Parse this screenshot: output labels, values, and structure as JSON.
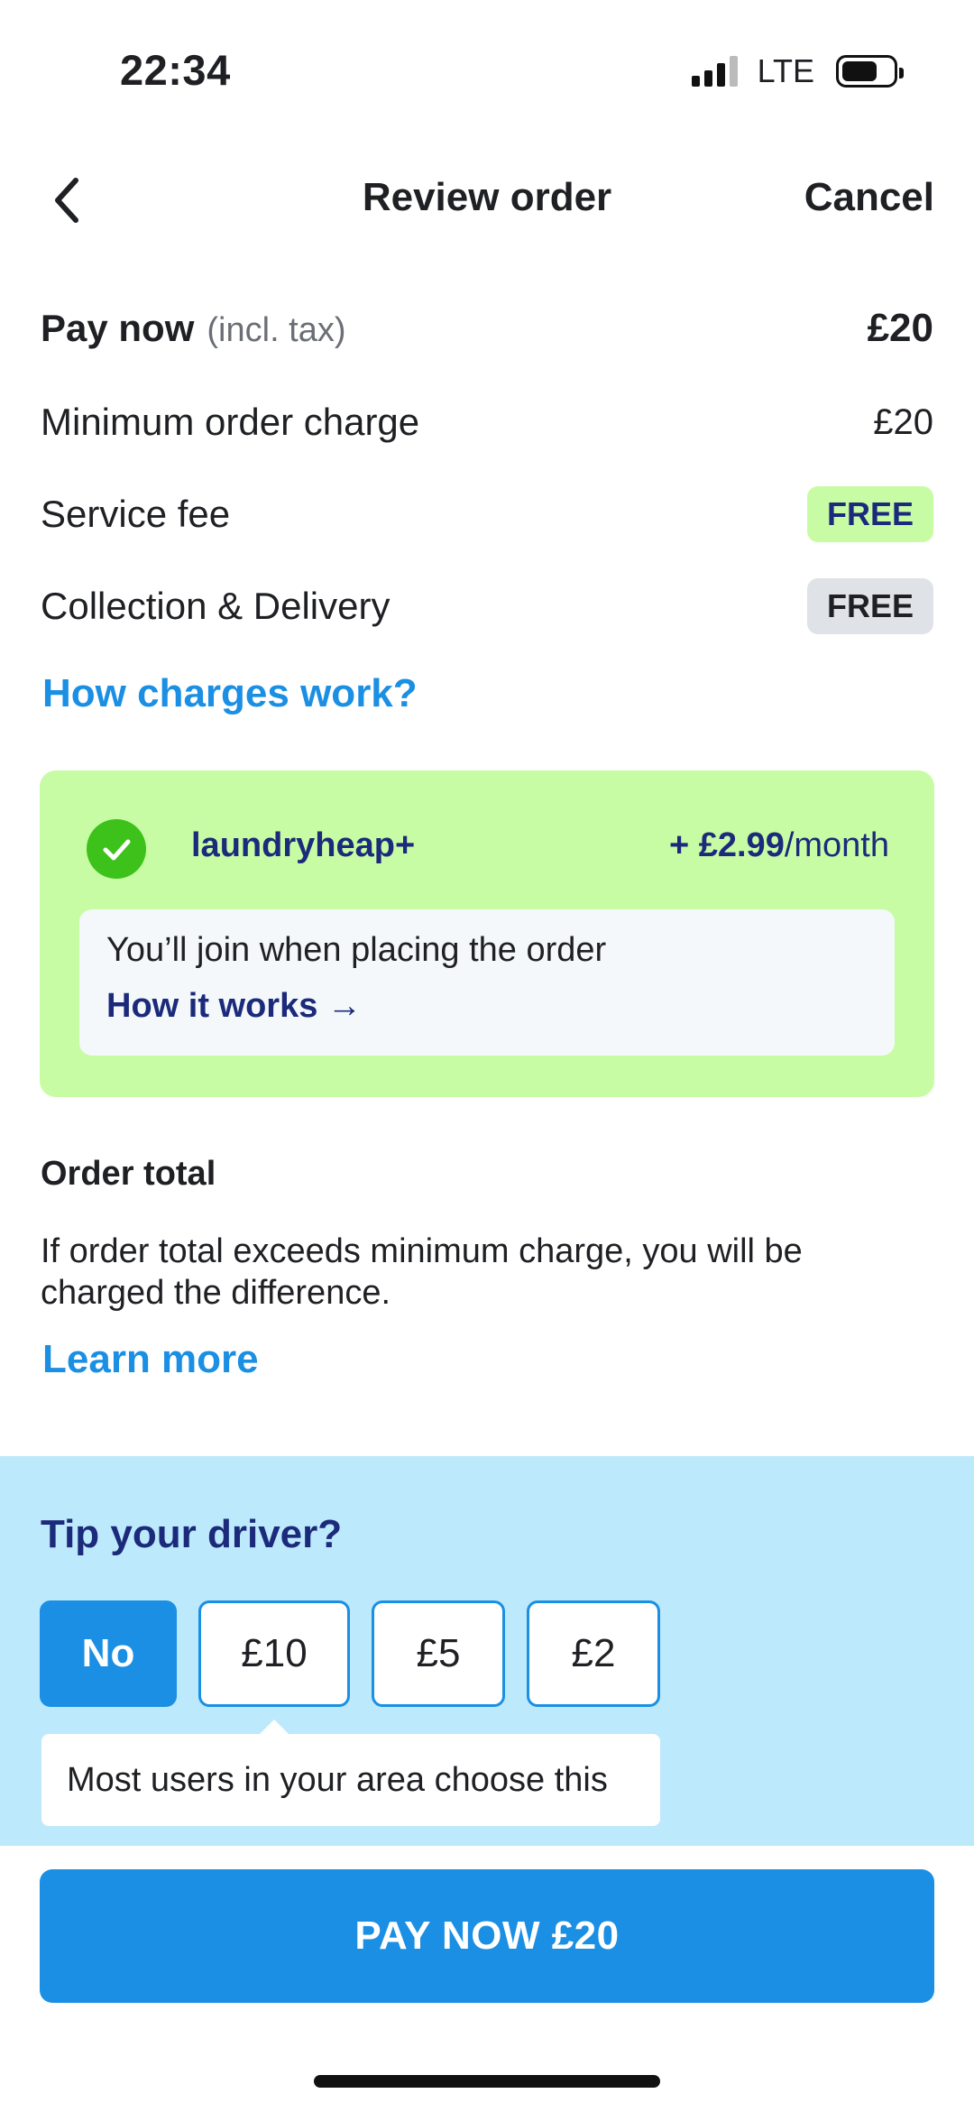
{
  "status_bar": {
    "time": "22:34",
    "network": "LTE",
    "icons": [
      "signal-icon",
      "battery-icon"
    ]
  },
  "header": {
    "title": "Review order",
    "cancel_label": "Cancel",
    "back_icon": "chevron-left-icon"
  },
  "charges": {
    "pay_now_label": "Pay now",
    "pay_now_sub": "(incl. tax)",
    "pay_now_amount": "£20",
    "items": [
      {
        "label": "Minimum order charge",
        "value": "£20"
      },
      {
        "label": "Service fee",
        "value": "FREE"
      },
      {
        "label": "Collection & Delivery",
        "value": "FREE"
      }
    ],
    "how_charges_link": "How charges work?"
  },
  "membership": {
    "name": "laundryheap+",
    "price": "+ £2.99",
    "period": "/month",
    "join_text": "You’ll join when placing the order",
    "how_link": "How it works →",
    "check_icon": "check-circle-icon"
  },
  "order_total": {
    "title": "Order total",
    "text": "If order total exceeds minimum charge, you will be charged the difference.",
    "learn_more": "Learn more"
  },
  "tip": {
    "title": "Tip your driver?",
    "options": [
      "No",
      "£10",
      "£5",
      "£2"
    ],
    "selected": "No",
    "tooltip": "Most users in your area choose this"
  },
  "pay_button": "PAY NOW £20",
  "colors": {
    "accent_blue": "#1a8fe3",
    "navy": "#1b2a7a",
    "green_bg": "#c8fca4",
    "check_green": "#3cc21a",
    "tip_bg": "#bde9fc"
  }
}
